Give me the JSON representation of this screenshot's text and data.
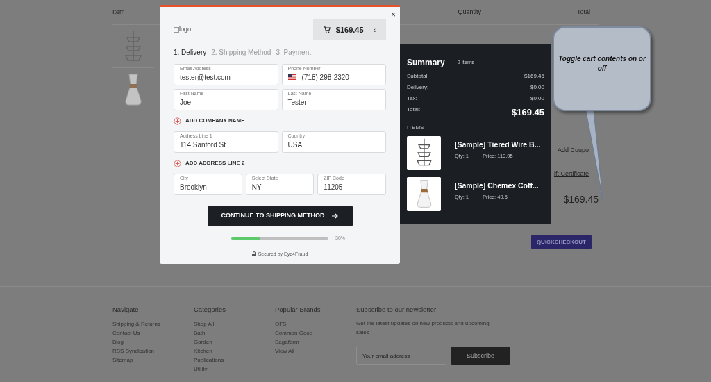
{
  "cart_page": {
    "columns": [
      "Item",
      "Quantity",
      "Total"
    ],
    "links": [
      "Add Coupo",
      "ift Certificate"
    ],
    "grand_total": "$169.45",
    "checkout_button": "QUICKCHECKOUT"
  },
  "checkout_modal": {
    "close": "×",
    "logo": "logo",
    "cart_toggle": {
      "amount": "$169.45",
      "chevron": "‹"
    },
    "steps": [
      {
        "label": "1. Delivery",
        "selected": true
      },
      {
        "label": "2. Shipping Method",
        "selected": false
      },
      {
        "label": "3. Payment",
        "selected": false
      }
    ],
    "rows": [
      [
        {
          "label": "Email Address",
          "value": "tester@test.com",
          "kind": "text"
        },
        {
          "label": "Phone Number",
          "value": "(718) 298-2320",
          "kind": "phone"
        }
      ],
      [
        {
          "label": "First Name",
          "value": "Joe",
          "kind": "text"
        },
        {
          "label": "Last Name",
          "value": "Tester",
          "kind": "text"
        }
      ],
      {
        "add": "ADD COMPANY NAME"
      },
      [
        {
          "label": "Address Line 1",
          "value": "114 Sanford St",
          "kind": "text"
        },
        {
          "label": "Country",
          "value": "USA",
          "kind": "text"
        }
      ],
      {
        "add": "ADD ADDRESS LINE 2"
      },
      [
        {
          "label": "City",
          "value": "Brooklyn",
          "kind": "text"
        },
        {
          "label": "Select State",
          "value": "NY",
          "kind": "text"
        },
        {
          "label": "ZIP Code",
          "value": "11205",
          "kind": "text"
        }
      ]
    ],
    "continue_button": "CONTINUE TO SHIPPING METHOD",
    "progress": {
      "level": 0.3,
      "reading": "30%"
    },
    "secured": "Secured by Eye4Fraud"
  },
  "summary": {
    "title": "Summary",
    "count": "2 items",
    "lines": [
      {
        "label": "Subtotal:",
        "value": "$169.45"
      },
      {
        "label": "Delivery:",
        "value": "$0.00"
      },
      {
        "label": "Tax:",
        "value": "$0.00"
      },
      {
        "label": "Total:",
        "value": "$169.45",
        "kind": "total"
      }
    ],
    "items_heading": "ITEMS",
    "items": [
      {
        "name": "[Sample] Tiered Wire B...",
        "qty": "Qty: 1",
        "price": "Price: 119.95",
        "kind": "tiered"
      },
      {
        "name": "[Sample] Chemex Coff...",
        "qty": "Qty: 1",
        "price": "Price: 49.5",
        "kind": "carafe"
      }
    ]
  },
  "callout": {
    "text": "Toggle cart contents on or off"
  },
  "footer": {
    "columns": [
      {
        "heading": "Navigate",
        "links": [
          "Shipping & Returns",
          "Contact Us",
          "Blog",
          "RSS Syndication",
          "Sitemap"
        ]
      },
      {
        "heading": "Categories",
        "links": [
          "Shop All",
          "Bath",
          "Garden",
          "Kitchen",
          "Publications",
          "Utility"
        ]
      },
      {
        "heading": "Popular Brands",
        "links": [
          "OFS",
          "Common Good",
          "Sagaform",
          "View All"
        ]
      }
    ],
    "newsletter": {
      "heading": "Subscribe to our newsletter",
      "text": "Get the latest updates on new products and upcoming sales",
      "placeholder": "Your email address",
      "button": "Subscribe"
    }
  }
}
